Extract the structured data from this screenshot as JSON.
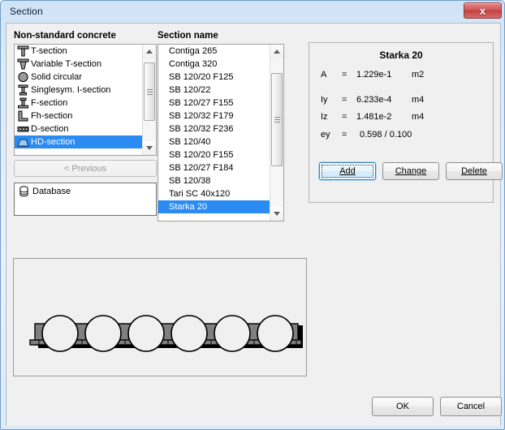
{
  "window": {
    "title": "Section",
    "close_label": "x",
    "close_icon": "close-icon"
  },
  "left_panel": {
    "group_label": "Non-standard concrete",
    "items": [
      {
        "label": "T-section",
        "icon": "t-section-icon",
        "selected": false
      },
      {
        "label": "Variable T-section",
        "icon": "variable-t-section-icon",
        "selected": false
      },
      {
        "label": "Solid circular",
        "icon": "solid-circular-icon",
        "selected": false
      },
      {
        "label": "Singlesym. I-section",
        "icon": "singlesym-i-section-icon",
        "selected": false
      },
      {
        "label": "F-section",
        "icon": "f-section-icon",
        "selected": false
      },
      {
        "label": "Fh-section",
        "icon": "fh-section-icon",
        "selected": false
      },
      {
        "label": "D-section",
        "icon": "d-section-icon",
        "selected": false
      },
      {
        "label": "HD-section",
        "icon": "hd-section-icon",
        "selected": true
      }
    ],
    "previous_button": "< Previous",
    "previous_enabled": false,
    "database_label": "Database",
    "database_icon": "database-icon"
  },
  "section_list": {
    "group_label": "Section name",
    "items": [
      {
        "label": "Contiga 265",
        "selected": false
      },
      {
        "label": "Contiga 320",
        "selected": false
      },
      {
        "label": "SB 120/20 F125",
        "selected": false
      },
      {
        "label": "SB 120/22",
        "selected": false
      },
      {
        "label": "SB 120/27 F155",
        "selected": false
      },
      {
        "label": "SB 120/32 F179",
        "selected": false
      },
      {
        "label": "SB 120/32 F236",
        "selected": false
      },
      {
        "label": "SB 120/40",
        "selected": false
      },
      {
        "label": "SB 120/20 F155",
        "selected": false
      },
      {
        "label": "SB 120/27 F184",
        "selected": false
      },
      {
        "label": "SB 120/38",
        "selected": false
      },
      {
        "label": "Tari SC 40x120",
        "selected": false
      },
      {
        "label": "Starka 20",
        "selected": true
      }
    ]
  },
  "properties": {
    "title": "Starka 20",
    "rows": [
      {
        "symbol": "A",
        "eq": "=",
        "value": "1.229e-1",
        "unit": "m2"
      },
      {
        "symbol": "Iy",
        "eq": "=",
        "value": "6.233e-4",
        "unit": "m4"
      },
      {
        "symbol": "Iz",
        "eq": "=",
        "value": "1.481e-2",
        "unit": "m4"
      },
      {
        "symbol": "ey",
        "eq": "=",
        "value": "0.598 / 0.100",
        "unit": ""
      }
    ],
    "buttons": {
      "add": "Add",
      "add_accel": "A",
      "change": "Change",
      "change_accel": "C",
      "delete": "Delete",
      "delete_accel": "D",
      "focused": "add"
    }
  },
  "preview": {
    "name": "hd-section-drawing",
    "void_count": 6,
    "fill_color": "#808080",
    "void_color": "#f0f0f0",
    "outline_color": "#000000"
  },
  "dialog_buttons": {
    "ok": "OK",
    "cancel": "Cancel"
  }
}
